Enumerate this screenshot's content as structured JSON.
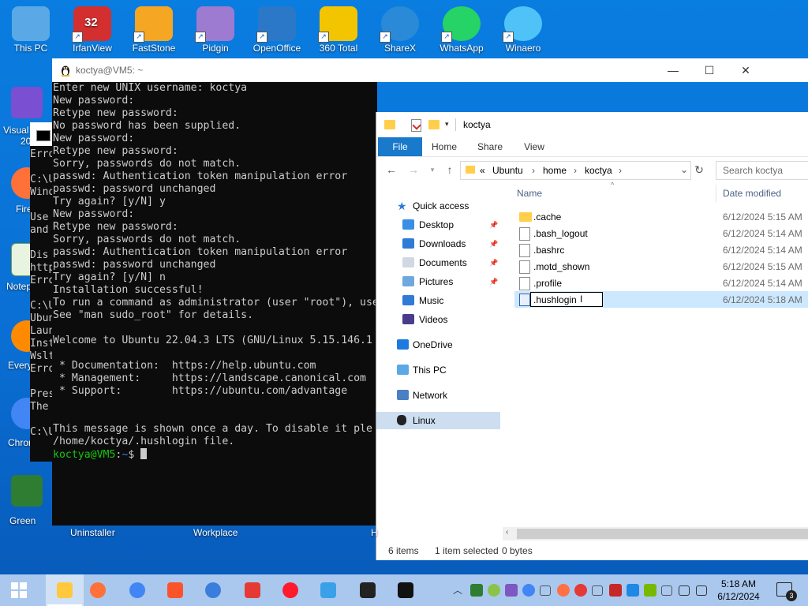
{
  "desktop": {
    "top_icons": [
      {
        "label": "This PC",
        "icon": "this-pc-icon",
        "color": "#5aa9e6"
      },
      {
        "label": "IrfanView",
        "icon": "irfanview-icon",
        "color": "#d32f2f",
        "badge": "32"
      },
      {
        "label": "FastStone",
        "icon": "faststone-icon",
        "color": "#f5a623"
      },
      {
        "label": "Pidgin",
        "icon": "pidgin-icon",
        "color": "#9c7bd1"
      },
      {
        "label": "OpenOffice",
        "icon": "openoffice-icon",
        "color": "#2b78c8"
      },
      {
        "label": "360 Total",
        "icon": "360-total-icon",
        "color": "#f2c500"
      },
      {
        "label": "ShareX",
        "icon": "sharex-icon",
        "color": "#2a8ad8"
      },
      {
        "label": "WhatsApp",
        "icon": "whatsapp-icon",
        "color": "#25d366"
      },
      {
        "label": "Winaero",
        "icon": "winaero-icon",
        "color": "#4fc3f7"
      }
    ],
    "left_labels": [
      "Visual",
      "20",
      "Fire",
      "Notep",
      "Every",
      "Chron",
      "Green"
    ],
    "bottom_labels": [
      "Uninstaller",
      "Workplace",
      "H"
    ]
  },
  "cmd_bg": {
    "lines": [
      "Erro",
      "C:\\U",
      "Wind",
      "Use",
      "and",
      "Dis",
      "http",
      "Erro",
      "C:\\U",
      "Ubun",
      "Laun",
      "Inst",
      "Wslt",
      "Erro",
      "Pres",
      "The",
      "C:\\U"
    ]
  },
  "terminal": {
    "title": "koctya@VM5: ~",
    "lines": [
      "Enter new UNIX username: koctya",
      "New password:",
      "Retype new password:",
      "No password has been supplied.",
      "New password:",
      "Retype new password:",
      "Sorry, passwords do not match.",
      "passwd: Authentication token manipulation error",
      "passwd: password unchanged",
      "Try again? [y/N] y",
      "New password:",
      "Retype new password:",
      "Sorry, passwords do not match.",
      "passwd: Authentication token manipulation error",
      "passwd: password unchanged",
      "Try again? [y/N] n",
      "Installation successful!",
      "To run a command as administrator (user \"root\"), use",
      "See \"man sudo_root\" for details.",
      "",
      "Welcome to Ubuntu 22.04.3 LTS (GNU/Linux 5.15.146.1",
      "",
      " * Documentation:  https://help.ubuntu.com",
      " * Management:     https://landscape.canonical.com",
      " * Support:        https://ubuntu.com/advantage",
      "",
      "",
      "This message is shown once a day. To disable it ple",
      "/home/koctya/.hushlogin file."
    ],
    "prompt_user": "koctya@VM5",
    "prompt_sep": ":",
    "prompt_path": "~",
    "prompt_end": "$ "
  },
  "explorer": {
    "title": "koctya",
    "ribbon_tabs": [
      "File",
      "Home",
      "Share",
      "View"
    ],
    "address": {
      "crumbs": [
        "«",
        "Ubuntu",
        "home",
        "koctya"
      ]
    },
    "search_placeholder": "Search koctya",
    "columns": {
      "name": "Name",
      "date": "Date modified"
    },
    "nav": [
      {
        "label": "Quick access",
        "icon": "star-icon",
        "color": "#2f7bd6"
      },
      {
        "label": "Desktop",
        "icon": "desktop-icon",
        "color": "#3a8ee6",
        "pinned": true
      },
      {
        "label": "Downloads",
        "icon": "download-icon",
        "color": "#2f7bd6",
        "pinned": true
      },
      {
        "label": "Documents",
        "icon": "documents-icon",
        "color": "#cfd8e3",
        "pinned": true
      },
      {
        "label": "Pictures",
        "icon": "pictures-icon",
        "color": "#6fa8dc",
        "pinned": true
      },
      {
        "label": "Music",
        "icon": "music-icon",
        "color": "#2f7bd6"
      },
      {
        "label": "Videos",
        "icon": "videos-icon",
        "color": "#4a3c8c"
      },
      {
        "label": "OneDrive",
        "icon": "onedrive-icon",
        "color": "#1f7ae0"
      },
      {
        "label": "This PC",
        "icon": "this-pc-icon",
        "color": "#5aa9e6"
      },
      {
        "label": "Network",
        "icon": "network-icon",
        "color": "#4a7fc1"
      },
      {
        "label": "Linux",
        "icon": "linux-icon",
        "color": "#222222"
      }
    ],
    "files": [
      {
        "name": ".cache",
        "date": "6/12/2024 5:15 AM",
        "type": "folder"
      },
      {
        "name": ".bash_logout",
        "date": "6/12/2024 5:14 AM",
        "type": "file"
      },
      {
        "name": ".bashrc",
        "date": "6/12/2024 5:14 AM",
        "type": "file"
      },
      {
        "name": ".motd_shown",
        "date": "6/12/2024 5:15 AM",
        "type": "file"
      },
      {
        "name": ".profile",
        "date": "6/12/2024 5:14 AM",
        "type": "file"
      },
      {
        "name": ".hushlogin",
        "date": "6/12/2024 5:18 AM",
        "type": "hush",
        "renaming": true
      }
    ],
    "status": {
      "items": "6 items",
      "selected": "1 item selected",
      "size": "0 bytes"
    }
  },
  "taskbar": {
    "time": "5:18 AM",
    "date": "6/12/2024",
    "notifications": "3",
    "apps": [
      {
        "icon": "start-icon",
        "color": "#ffffff"
      },
      {
        "icon": "file-explorer-icon",
        "color": "#ffc83d",
        "active": true
      },
      {
        "icon": "firefox-icon",
        "color": "#ff7139"
      },
      {
        "icon": "chrome-icon",
        "color": "#4285f4"
      },
      {
        "icon": "brave-icon",
        "color": "#fb542b"
      },
      {
        "icon": "chromium-icon",
        "color": "#3b7ddd"
      },
      {
        "icon": "wps-icon",
        "color": "#e53935"
      },
      {
        "icon": "opera-icon",
        "color": "#ff1b2d"
      },
      {
        "icon": "wing-icon",
        "color": "#3aa0e8"
      },
      {
        "icon": "terminal-icon",
        "color": "#222222"
      },
      {
        "icon": "linux-icon",
        "color": "#111111"
      }
    ],
    "tray": [
      {
        "icon": "chevron-up-icon",
        "color": "#333333"
      },
      {
        "icon": "shield-icon",
        "color": "#2e7d32"
      },
      {
        "icon": "360-icon",
        "color": "#8bc34a"
      },
      {
        "icon": "pen-icon",
        "color": "#7e57c2"
      },
      {
        "icon": "chrome-tray-icon",
        "color": "#4285f4"
      },
      {
        "icon": "bluetooth-icon",
        "color": "#555555"
      },
      {
        "icon": "media-icon",
        "color": "#ff7043"
      },
      {
        "icon": "record-icon",
        "color": "#e53935"
      },
      {
        "icon": "warning-icon",
        "color": "#555555"
      },
      {
        "icon": "norton-icon",
        "color": "#c62828"
      },
      {
        "icon": "sharex-tray-icon",
        "color": "#1e88e5"
      },
      {
        "icon": "nvidia-icon",
        "color": "#76b900"
      },
      {
        "icon": "usb-icon",
        "color": "#555555"
      },
      {
        "icon": "network-tray-icon",
        "color": "#333333"
      },
      {
        "icon": "volume-icon",
        "color": "#333333"
      }
    ]
  }
}
